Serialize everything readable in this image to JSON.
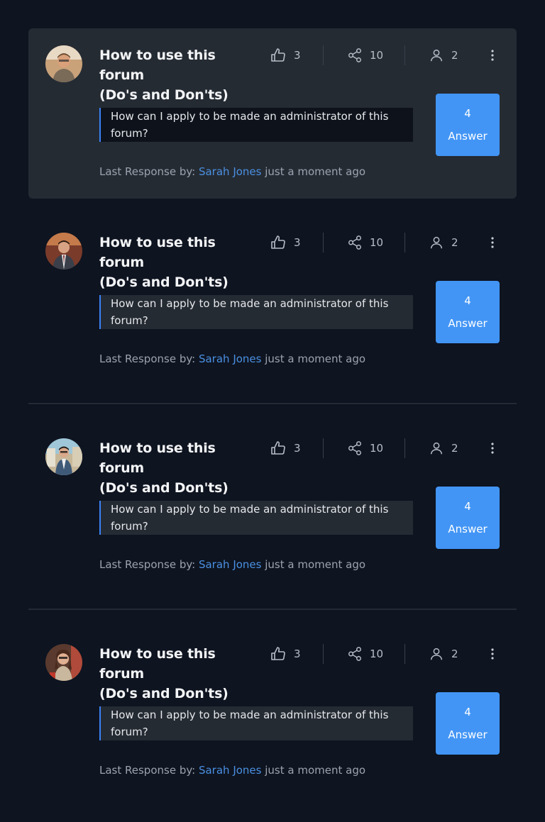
{
  "colors": {
    "background": "#0e1420",
    "card_highlight": "#252b33",
    "accent": "#4295f5",
    "link": "#4a90e2"
  },
  "threads": [
    {
      "title_line1": "How to use this forum",
      "title_line2": "(Do's and Don'ts)",
      "likes": "3",
      "shares": "10",
      "participants": "2",
      "question": "How can I apply to be made an administrator of this forum?",
      "answer_count": "4",
      "answer_label": "Answer",
      "last_response_prefix": "Last Response by:",
      "last_response_user": "Sarah Jones",
      "last_response_time": "just a moment ago"
    },
    {
      "title_line1": "How to use this forum",
      "title_line2": "(Do's and Don'ts)",
      "likes": "3",
      "shares": "10",
      "participants": "2",
      "question": "How can I apply to be made an administrator of this forum?",
      "answer_count": "4",
      "answer_label": "Answer",
      "last_response_prefix": "Last Response by:",
      "last_response_user": "Sarah Jones",
      "last_response_time": "just a moment ago"
    },
    {
      "title_line1": "How to use this forum",
      "title_line2": "(Do's and Don'ts)",
      "likes": "3",
      "shares": "10",
      "participants": "2",
      "question": "How can I apply to be made an administrator of this forum?",
      "answer_count": "4",
      "answer_label": "Answer",
      "last_response_prefix": "Last Response by:",
      "last_response_user": "Sarah Jones",
      "last_response_time": "just a moment ago"
    },
    {
      "title_line1": "How to use this forum",
      "title_line2": "(Do's and Don'ts)",
      "likes": "3",
      "shares": "10",
      "participants": "2",
      "question": "How can I apply to be made an administrator of this forum?",
      "answer_count": "4",
      "answer_label": "Answer",
      "last_response_prefix": "Last Response by:",
      "last_response_user": "Sarah Jones",
      "last_response_time": "just a moment ago"
    }
  ],
  "icons": {
    "likes": "thumbs-up-icon",
    "shares": "share-icon",
    "participants": "user-icon",
    "more": "more-vertical-icon"
  }
}
